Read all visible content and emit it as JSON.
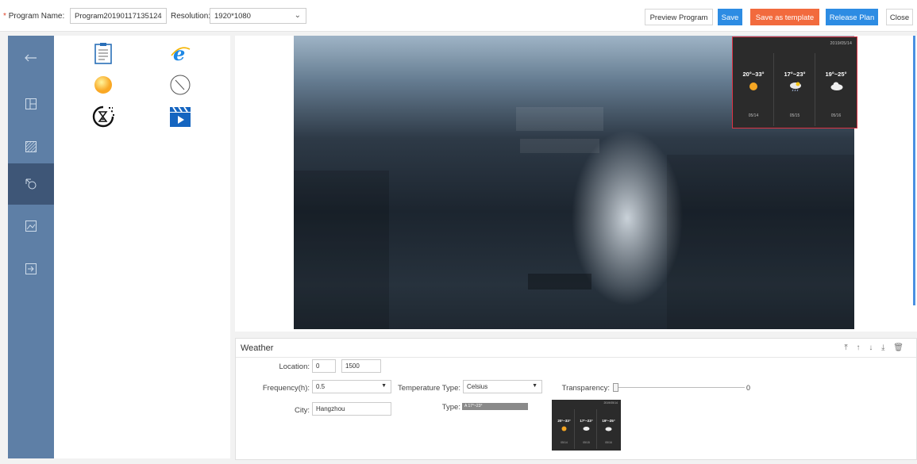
{
  "toolbar": {
    "required_mark": "*",
    "program_name_label": "Program Name:",
    "program_name_value": "Program20190117135124",
    "resolution_label": "Resolution:",
    "resolution_value": "1920*1080",
    "preview_label": "Preview Program",
    "save_label": "Save",
    "save_template_label": "Save as template",
    "release_label": "Release Plan",
    "close_label": "Close",
    "colors": {
      "blue": "#2d8ce3",
      "orange": "#f26a3d"
    }
  },
  "sidebar": {
    "items": [
      {
        "icon": "back-arrow-icon",
        "glyph": "←"
      },
      {
        "icon": "layout-icon",
        "glyph": ""
      },
      {
        "icon": "texture-icon",
        "glyph": ""
      },
      {
        "icon": "widgets-icon",
        "glyph": "",
        "active": true
      },
      {
        "icon": "image-icon",
        "glyph": ""
      },
      {
        "icon": "exit-icon",
        "glyph": ""
      }
    ],
    "color": "#5e7fa6"
  },
  "tools": [
    {
      "icon": "document-icon"
    },
    {
      "icon": "browser-e-icon"
    },
    {
      "icon": "weather-sun-icon"
    },
    {
      "icon": "clock-icon"
    },
    {
      "icon": "timer-icon"
    },
    {
      "icon": "video-clapper-icon"
    }
  ],
  "weather_widget": {
    "date": "2019/05/14",
    "days": [
      {
        "temp": "20°~33°",
        "icon": "sunny-icon",
        "day": "05/14"
      },
      {
        "temp": "17°~23°",
        "icon": "rain-cloud-icon",
        "day": "05/15"
      },
      {
        "temp": "19°~25°",
        "icon": "cloud-icon",
        "day": "05/16"
      }
    ]
  },
  "properties": {
    "title": "Weather",
    "toolbar_icons": "⤒ ↑ ↓ ⤓ 🗑",
    "location_label": "Location:",
    "location_x": "0",
    "location_y": "1500",
    "frequency_label": "Frequency(h):",
    "frequency_value": "0.5",
    "temp_type_label": "Temperature Type:",
    "temp_type_value": "Celsius",
    "transparency_label": "Transparency:",
    "transparency_value": "0",
    "city_label": "City:",
    "city_value": "Hangzhou",
    "type_label": "Type:",
    "type_swatch_text": "A       17°~23°",
    "mini_preview": {
      "date": "2019/05/14",
      "temps": [
        "20°~33°",
        "17°~23°",
        "19°~25°"
      ],
      "days": [
        "05/14",
        "05/15",
        "05/16"
      ]
    }
  }
}
